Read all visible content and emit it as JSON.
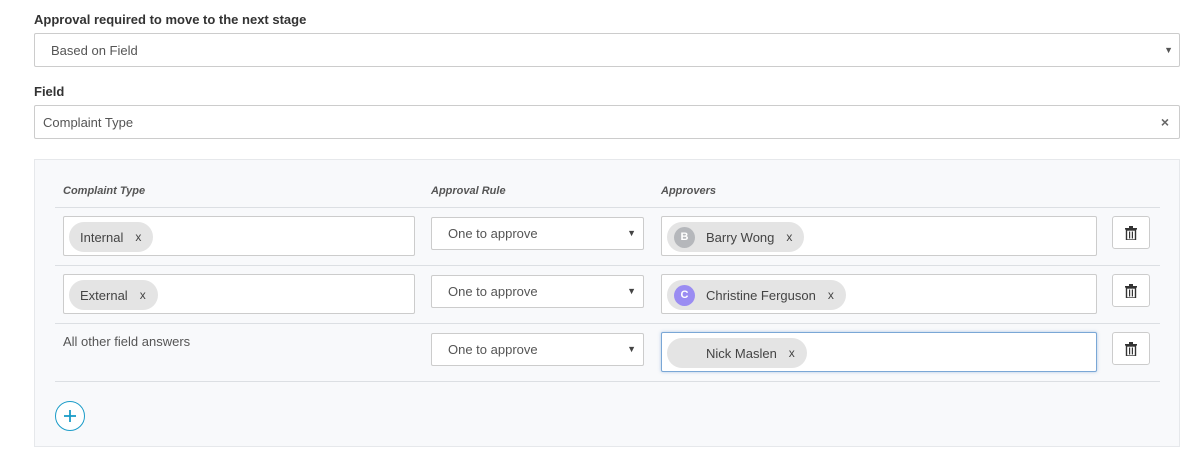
{
  "approval": {
    "label": "Approval required to move to the next stage",
    "selected": "Based on Field"
  },
  "field": {
    "label": "Field",
    "value": "Complaint Type"
  },
  "table": {
    "headers": {
      "col1": "Complaint Type",
      "col2": "Approval Rule",
      "col3": "Approvers"
    },
    "rows": [
      {
        "answer_tag": "Internal",
        "rule": "One to approve",
        "approver": {
          "initial": "B",
          "name": "Barry Wong",
          "avatar_color": "#b5b7bb"
        }
      },
      {
        "answer_tag": "External",
        "rule": "One to approve",
        "approver": {
          "initial": "C",
          "name": "Christine Ferguson",
          "avatar_color": "#9a8cf2"
        }
      },
      {
        "answer_text": "All other field answers",
        "rule": "One to approve",
        "approver": {
          "initial": "",
          "name": "Nick Maslen",
          "avatar_color": "transparent"
        }
      }
    ]
  },
  "glyphs": {
    "remove": "x",
    "caret": "▼",
    "clear": "×"
  },
  "colors": {
    "accent": "#1b9cc8",
    "panel_bg": "#f8f9fb",
    "chip_bg": "#e4e4e4"
  }
}
